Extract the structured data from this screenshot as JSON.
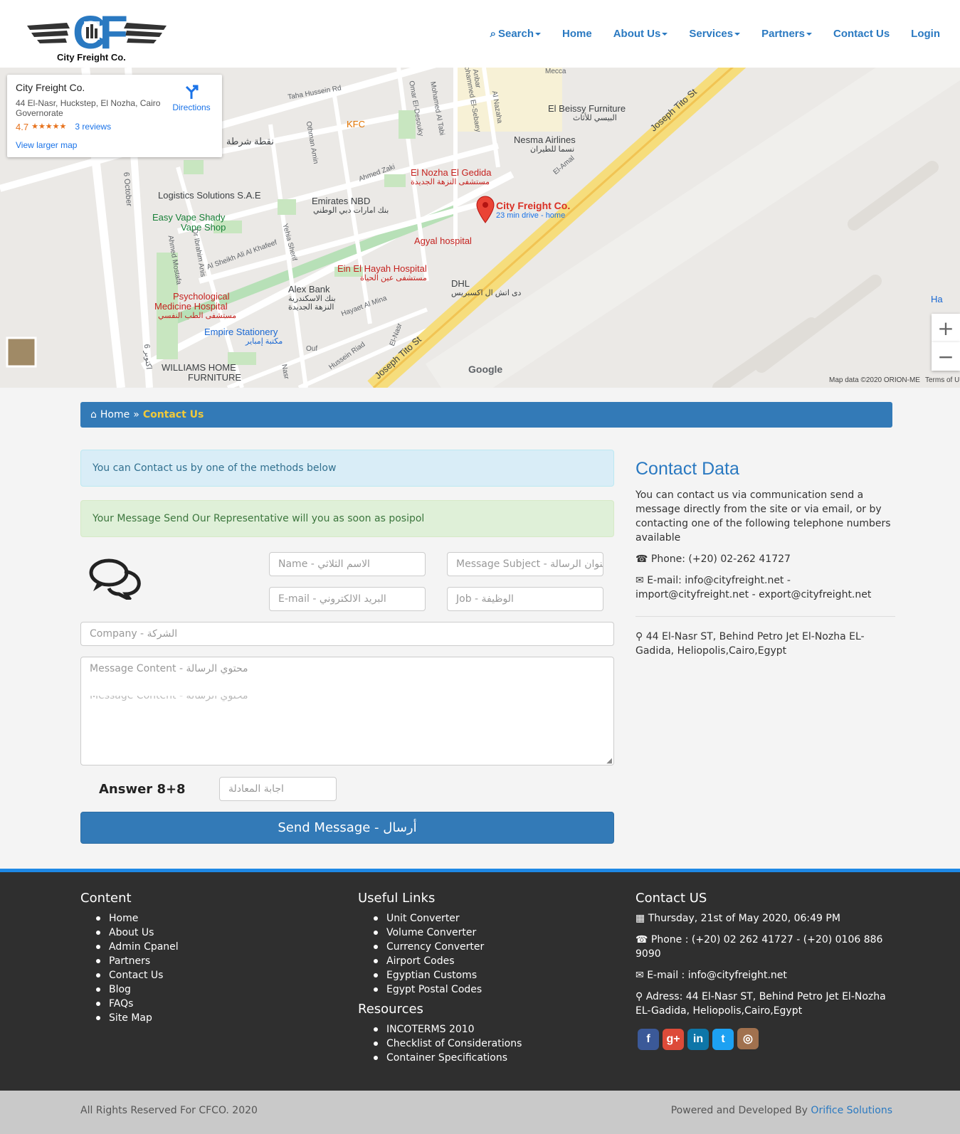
{
  "brand": {
    "name": "City Freight Co.",
    "logo_letters": "CF"
  },
  "nav": [
    {
      "label": "Search",
      "dropdown": true
    },
    {
      "label": "Home",
      "dropdown": false
    },
    {
      "label": "About Us",
      "dropdown": true
    },
    {
      "label": "Services",
      "dropdown": true
    },
    {
      "label": "Partners",
      "dropdown": true
    },
    {
      "label": "Contact Us",
      "dropdown": false
    },
    {
      "label": "Login",
      "dropdown": false
    }
  ],
  "map": {
    "card": {
      "title": "City Freight Co.",
      "address": "44 El-Nasr, Huckstep, El Nozha, Cairo Governorate",
      "rating": "4.7",
      "stars": "★★★★★",
      "reviews": "3 reviews",
      "directions": "Directions",
      "larger": "View larger map"
    },
    "pin": {
      "title": "City Freight Co.",
      "sub": "23 min drive - home"
    },
    "labels": {
      "kfc": "KFC",
      "nozha": "El Nozha El Gedida",
      "nozha_ar": "مستشفى النزهة الجديدة",
      "beissy": "El Beissy Furniture",
      "beissy_ar": "البيسي للأثاث",
      "nesma": "Nesma Airlines",
      "nesma_ar": "نسما للطيران",
      "logistics": "Logistics Solutions S.A.E",
      "emirates": "Emirates NBD",
      "emirates_ar": "بنك امارات دبي الوطني",
      "vape": "Easy Vape Shady",
      "vape2": "Vape Shop",
      "agyal": "Agyal hospital",
      "einelhayah": "Ein El Hayah Hospital",
      "einelhayah_ar": "مستشفى عين الحياة",
      "dhl": "DHL",
      "dhl_ar": "دى اتش ال اكسبريس",
      "alexbank": "Alex Bank",
      "alexbank_ar": "بنك الاسكندرية",
      "alexbank_ar2": "النزهة الجديدة",
      "psych": "Psychological",
      "psych2": "Medicine Hospital",
      "psych_ar": "مستشفى الطب النفسي",
      "empire": "Empire Stationery",
      "empire_ar": "مكتبة إمباير",
      "williams": "WILLIAMS HOME",
      "williams2": "FURNITURE",
      "police": "نقطة شرطة",
      "joseph": "Joseph Tito St",
      "joseph2": "Joseph Tito St",
      "taha": "Taha Hussein Rd",
      "october": "6 October",
      "october_ar": "6 اكتوبر",
      "ahmedzaki": "Ahmed Zaki",
      "ahmedmostafa": "Ahmed Mostafa",
      "ibrahim": "Dr Ibrahim Anis",
      "sheikh": "Al Sheikh Ali Al Khafeef",
      "yehia": "Yehia Sherif",
      "othman": "Othman Amin",
      "omar": "Omar El-Desouky",
      "mtabi": "Mohamed Al Tabi",
      "msebaey": "Mohammed El-Sebaey",
      "anbar": "Anbar",
      "nazaha": "Al Nazaha",
      "elamal": "El-Amal",
      "hayaet": "Hayaet Al Mina",
      "ouf": "Ouf",
      "husseinrd": "Hussein Riad",
      "elnasr": "El-Nasr",
      "mecca": "Mecca",
      "nasr": "Nasr",
      "ha": "Ha",
      "google": "Google",
      "mapdata": "Map data ©2020 ORION-ME",
      "terms": "Terms of U"
    }
  },
  "breadcrumb": {
    "home": "Home",
    "sep": "»",
    "current": "Contact Us"
  },
  "alerts": {
    "info": "You can Contact us by one of the methods below",
    "success": "Your Message Send Our Representative will you as soon as posipol"
  },
  "form": {
    "name": "Name - الاسم الثلاثي",
    "subject": "Message Subject - عنوان الرسالة",
    "email": "E-mail - البريد الالكتروني",
    "job": "Job - الوظيفة",
    "company": "Company - الشركة",
    "message": "Message Content - محتوي الرسالة",
    "message_ghost": "Message Content - محتوي الرسالة",
    "captcha_label": "Answer 8+8",
    "captcha": "اجابة المعادلة",
    "send": "Send Message - أرسال"
  },
  "contact": {
    "heading": "Contact Data",
    "intro": "You can contact us via communication send a message directly from the site or via email, or by contacting one of the following telephone numbers available",
    "phone": "Phone: (+20) 02-262 41727",
    "email": "E-mail: info@cityfreight.net - import@cityfreight.net - export@cityfreight.net",
    "address": "44 El-Nasr ST, Behind Petro Jet El-Nozha EL-Gadida, Heliopolis,Cairo,Egypt"
  },
  "footer": {
    "content_title": "Content",
    "content_links": [
      "Home",
      "About Us",
      "Admin Cpanel",
      "Partners",
      "Contact Us",
      "Blog",
      "FAQs",
      "Site Map"
    ],
    "useful_title": "Useful Links",
    "useful_links": [
      "Unit Converter",
      "Volume Converter",
      "Currency Converter",
      "Airport Codes",
      "Egyptian Customs",
      "Egypt Postal Codes"
    ],
    "resources_title": "Resources",
    "resources_links": [
      "INCOTERMS 2010",
      "Checklist of Considerations",
      "Container Specifications"
    ],
    "contact_title": "Contact US",
    "date": "Thursday, 21st of May 2020, 06:49 PM",
    "phone": "Phone : (+20) 02 262 41727 - (+20) 0106 886 9090",
    "email": "E-mail : info@cityfreight.net",
    "address": "Adress: 44 El-Nasr ST, Behind Petro Jet El-Nozha EL-Gadida, Heliopolis,Cairo,Egypt",
    "social": [
      {
        "name": "facebook-icon",
        "glyph": "f",
        "color": "#3b5998"
      },
      {
        "name": "google-plus-icon",
        "glyph": "g+",
        "color": "#dd4b39"
      },
      {
        "name": "linkedin-icon",
        "glyph": "in",
        "color": "#0e76a8"
      },
      {
        "name": "twitter-icon",
        "glyph": "t",
        "color": "#1da1f2"
      },
      {
        "name": "instagram-icon",
        "glyph": "◎",
        "color": "#a1714e"
      }
    ]
  },
  "copyright": {
    "left": "All Rights Reserved For CFCO. 2020",
    "powered": "Powered and Developed By",
    "company": "Orifice Solutions"
  },
  "colors": {
    "primary": "#337ab7",
    "accent_link": "#2a79c1",
    "breadcrumb_current": "#f0c93a",
    "footer_bg": "#2f2f2f",
    "footer_border": "#1e88e5"
  }
}
